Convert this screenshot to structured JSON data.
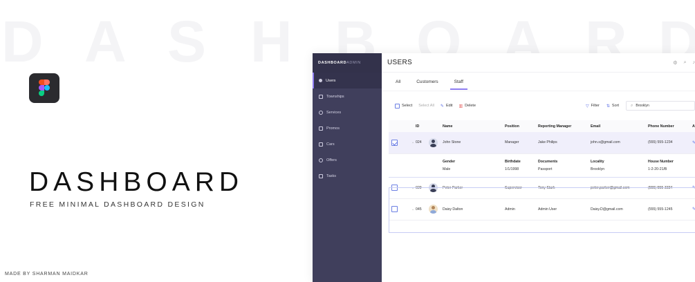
{
  "watermark": {
    "letters": [
      "D",
      "A",
      "S",
      "H",
      "B",
      "O",
      "A",
      "R",
      "D"
    ]
  },
  "hero": {
    "title": "DASHBOARD",
    "subtitle": "FREE MINIMAL DASHBOARD DESIGN",
    "credit": "MADE BY SHARMAN MAIDKAR"
  },
  "app": {
    "brand_bold": "DASHBOARD",
    "brand_light": "ADMIN",
    "nav": [
      {
        "label": "Users",
        "icon": "user-icon",
        "active": true
      },
      {
        "label": "Townships",
        "icon": "building-icon"
      },
      {
        "label": "Services",
        "icon": "gear-icon"
      },
      {
        "label": "Promos",
        "icon": "card-icon"
      },
      {
        "label": "Cars",
        "icon": "car-icon"
      },
      {
        "label": "Offers",
        "icon": "tag-icon"
      },
      {
        "label": "Tasks",
        "icon": "clipboard-icon"
      }
    ],
    "page_title": "USERS",
    "tabs": [
      "All",
      "Customers",
      "Staff"
    ],
    "active_tab": "Staff",
    "toolbar": {
      "select": "Select",
      "select_all": "Select All",
      "edit": "Edit",
      "delete": "Delete",
      "filter": "Filter",
      "sort": "Sort",
      "search_value": "Brooklyn"
    },
    "table": {
      "headers": [
        "ID",
        "Name",
        "Position",
        "Reporting Manager",
        "Email",
        "Phone Number",
        "A"
      ],
      "rows": [
        {
          "id": "024",
          "name": "John Stone",
          "position": "Manager",
          "manager": "Jake Philips",
          "email": "john.s@gmail.com",
          "phone": "(555) 555-1234",
          "checked": true
        },
        {
          "id": "029",
          "name": "Peter Parker",
          "position": "Supervisor",
          "manager": "Tony Stark",
          "email": "peter.parker@gmail.com",
          "phone": "(555) 555-3334",
          "checked": false
        },
        {
          "id": "045",
          "name": "Daisy Dalton",
          "position": "Admin",
          "manager": "Admin User",
          "email": "Daisy.D@gmail.com",
          "phone": "(555) 555-1245",
          "checked": false
        }
      ],
      "detail": {
        "gender_label": "Gender",
        "gender": "Male",
        "birthdate_label": "Birthdate",
        "birthdate": "1/1/1998",
        "documents_label": "Documents",
        "documents": "Passport",
        "locality_label": "Locality",
        "locality": "Brooklyn",
        "house_label": "House Number",
        "house": "1-2-20-21/B"
      }
    }
  },
  "colors": {
    "sidebar": "#403f5c",
    "accent": "#8d7cf0",
    "link": "#5b6de6",
    "danger": "#e35b5b"
  }
}
